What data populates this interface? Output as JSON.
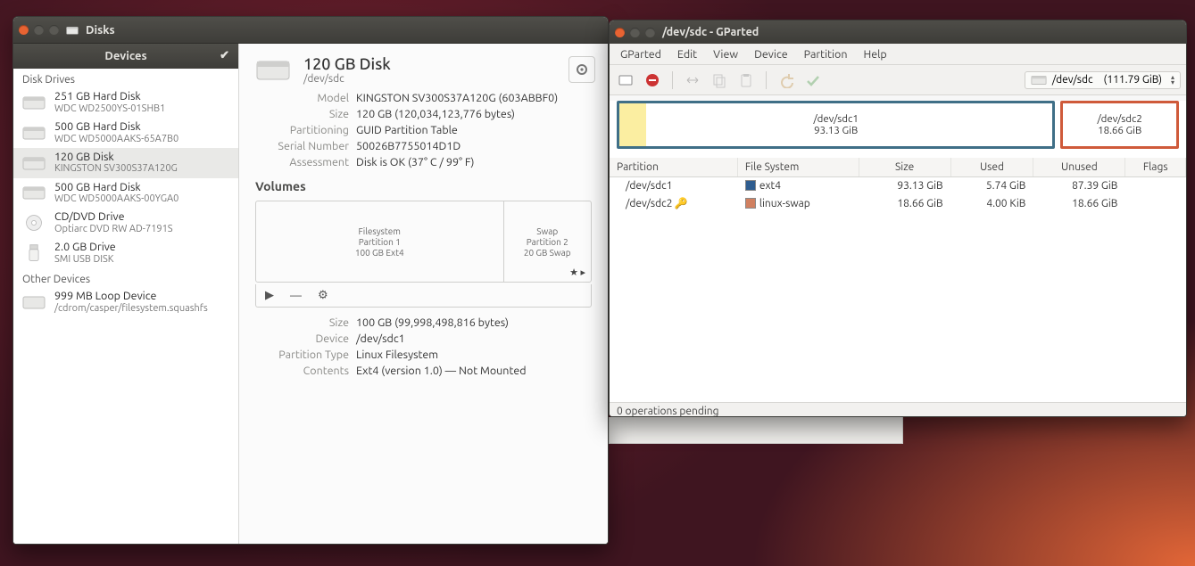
{
  "disks": {
    "title": "Disks",
    "devices_header": "Devices",
    "sections": {
      "disk_drives": "Disk Drives",
      "other_devices": "Other Devices"
    },
    "drives": [
      {
        "name": "251 GB Hard Disk",
        "sub": "WDC WD2500YS-01SHB1",
        "icon": "hdd"
      },
      {
        "name": "500 GB Hard Disk",
        "sub": "WDC WD5000AAKS-65A7B0",
        "icon": "hdd"
      },
      {
        "name": "120 GB Disk",
        "sub": "KINGSTON SV300S37A120G",
        "icon": "hdd",
        "selected": true
      },
      {
        "name": "500 GB Hard Disk",
        "sub": "WDC WD5000AAKS-00YGA0",
        "icon": "hdd"
      },
      {
        "name": "CD/DVD Drive",
        "sub": "Optiarc DVD RW AD-7191S",
        "icon": "optical"
      },
      {
        "name": "2.0 GB Drive",
        "sub": "SMI USB DISK",
        "icon": "usb"
      }
    ],
    "other": [
      {
        "name": "999 MB Loop Device",
        "sub": "/cdrom/casper/filesystem.squashfs",
        "icon": "loop"
      }
    ],
    "detail": {
      "title": "120 GB Disk",
      "path": "/dev/sdc",
      "rows": {
        "model_k": "Model",
        "model_v": "KINGSTON SV300S37A120G (603ABBF0)",
        "size_k": "Size",
        "size_v": "120 GB (120,034,123,776 bytes)",
        "part_k": "Partitioning",
        "part_v": "GUID Partition Table",
        "serial_k": "Serial Number",
        "serial_v": "50026B7755014D1D",
        "assess_k": "Assessment",
        "assess_v": "Disk is OK (37° C / 99° F)"
      },
      "volumes_header": "Volumes",
      "vol_main": {
        "l1": "Filesystem",
        "l2": "Partition 1",
        "l3": "100 GB Ext4"
      },
      "vol_swap": {
        "l1": "Swap",
        "l2": "Partition 2",
        "l3": "20 GB Swap"
      },
      "toolbar": {
        "play": "▶",
        "minus": "—",
        "gear": "⚙"
      },
      "sel": {
        "size_k": "Size",
        "size_v": "100 GB (99,998,498,816 bytes)",
        "device_k": "Device",
        "device_v": "/dev/sdc1",
        "ptype_k": "Partition Type",
        "ptype_v": "Linux Filesystem",
        "contents_k": "Contents",
        "contents_v": "Ext4 (version 1.0) — Not Mounted"
      }
    }
  },
  "gparted": {
    "title": "/dev/sdc - GParted",
    "menus": [
      "GParted",
      "Edit",
      "View",
      "Device",
      "Partition",
      "Help"
    ],
    "device_selector": {
      "dev": "/dev/sdc",
      "size": "(111.79 GiB)"
    },
    "map": {
      "big": {
        "name": "/dev/sdc1",
        "size": "93.13 GiB"
      },
      "small": {
        "name": "/dev/sdc2",
        "size": "18.66 GiB"
      }
    },
    "table": {
      "headers": [
        "Partition",
        "File System",
        "Size",
        "Used",
        "Unused",
        "Flags"
      ],
      "rows": [
        {
          "part": "/dev/sdc1",
          "key": false,
          "fs": "ext4",
          "fs_class": "fs-ext4",
          "size": "93.13 GiB",
          "used": "5.74 GiB",
          "unused": "87.39 GiB",
          "flags": ""
        },
        {
          "part": "/dev/sdc2",
          "key": true,
          "fs": "linux-swap",
          "fs_class": "fs-swap",
          "size": "18.66 GiB",
          "used": "4.00 KiB",
          "unused": "18.66 GiB",
          "flags": ""
        }
      ]
    },
    "status": "0 operations pending"
  }
}
